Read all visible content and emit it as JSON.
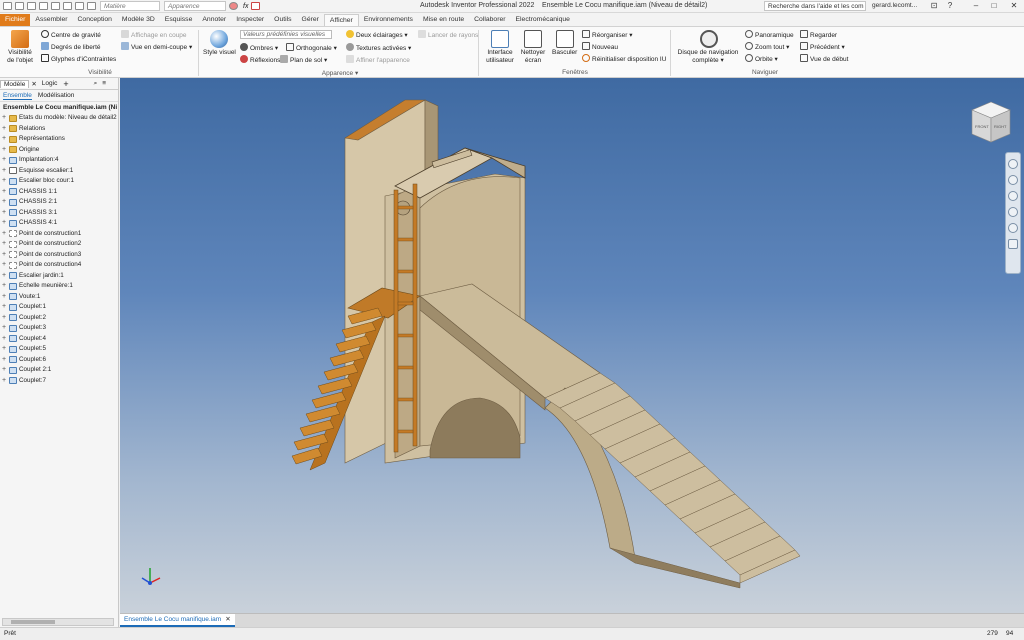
{
  "quick_access": {
    "material_placeholder": "Matière",
    "appearance_placeholder": "Apparence",
    "fx_label": "fx"
  },
  "title": {
    "app": "Autodesk Inventor Professional 2022",
    "document": "Ensemble Le Cocu manifique.iam (Niveau de détail2)"
  },
  "help_search": "Recherche dans l'aide et les com",
  "user": "gerard.lecomt...",
  "ribbon_tabs": [
    "Fichier",
    "Assembler",
    "Conception",
    "Modèle 3D",
    "Esquisse",
    "Annoter",
    "Inspecter",
    "Outils",
    "Gérer",
    "Afficher",
    "Environnements",
    "Mise en route",
    "Collaborer",
    "Electromécanique"
  ],
  "active_tab": "Afficher",
  "ribbon": {
    "visibility": {
      "object_visibility_line1": "Visibilité",
      "object_visibility_line2": "de l'objet",
      "gravity_center": "Centre de gravité",
      "dof": "Degrés de liberté",
      "constraint_glyphs": "Glyphes d'iContraintes",
      "half_section_view": "Affichage en coupe",
      "half_view": "Vue en demi-coupe",
      "group_label": "Visibilité"
    },
    "appearance": {
      "visual_style": "Style visuel",
      "visual_presets": "Valeurs prédéfinies visuelles",
      "two_lights": "Deux éclairages",
      "ray_tracing": "Lancer de rayons",
      "shadows": "Ombres",
      "orthographic": "Orthogonale",
      "textures_on": "Textures activées",
      "reflections": "Réflexions",
      "ground_plane": "Plan de sol",
      "refine_appearance": "Affiner l'apparence",
      "group_label": "Apparence"
    },
    "windows": {
      "ui_line1": "Interface",
      "ui_line2": "utilisateur",
      "clean_line1": "Nettoyer",
      "clean_line2": "écran",
      "switch": "Basculer",
      "arrange": "Réorganiser",
      "new": "Nouveau",
      "reset_ui": "Réinitialiser disposition IU",
      "group_label": "Fenêtres"
    },
    "navigate": {
      "nav_wheel_line1": "Disque de navigation",
      "nav_wheel_line2": "complète",
      "pan": "Panoramique",
      "zoom_all": "Zoom tout",
      "orbit": "Orbite",
      "look": "Regarder",
      "previous": "Précédent",
      "home_view": "Vue de début",
      "group_label": "Naviguer"
    }
  },
  "browser": {
    "tabs": [
      "Modèle",
      "Logic"
    ],
    "subtabs": [
      "Ensemble",
      "Modélisation"
    ],
    "root": "Ensemble Le Cocu manifique.iam (Ni",
    "items": [
      {
        "label": "Etats du modèle: Niveau de détail2",
        "icon": "folder",
        "expand": true
      },
      {
        "label": "Relations",
        "icon": "folder",
        "expand": true
      },
      {
        "label": "Représentations",
        "icon": "folder",
        "expand": true
      },
      {
        "label": "Origine",
        "icon": "folder",
        "expand": true
      },
      {
        "label": "Implantation:4",
        "icon": "part",
        "expand": true
      },
      {
        "label": "Esquisse escalier:1",
        "icon": "sketch",
        "expand": true
      },
      {
        "label": "Escalier bloc cour:1",
        "icon": "part",
        "expand": true
      },
      {
        "label": "CHASSIS 1:1",
        "icon": "part",
        "expand": true
      },
      {
        "label": "CHASSIS 2:1",
        "icon": "part",
        "expand": true
      },
      {
        "label": "CHASSIS 3:1",
        "icon": "part",
        "expand": true
      },
      {
        "label": "CHASSIS 4:1",
        "icon": "part",
        "expand": true
      },
      {
        "label": "Point de construction1",
        "icon": "point",
        "expand": true
      },
      {
        "label": "Point de construction2",
        "icon": "point",
        "expand": true
      },
      {
        "label": "Point de construction3",
        "icon": "point",
        "expand": true
      },
      {
        "label": "Point de construction4",
        "icon": "point",
        "expand": true
      },
      {
        "label": "Escalier jardin:1",
        "icon": "part",
        "expand": true
      },
      {
        "label": "Echelle meunière:1",
        "icon": "part",
        "expand": true
      },
      {
        "label": "Voute:1",
        "icon": "part",
        "expand": true
      },
      {
        "label": "Couplet:1",
        "icon": "part",
        "expand": true
      },
      {
        "label": "Couplet:2",
        "icon": "part",
        "expand": true
      },
      {
        "label": "Couplet:3",
        "icon": "part",
        "expand": true
      },
      {
        "label": "Couplet:4",
        "icon": "part",
        "expand": true
      },
      {
        "label": "Couplet:5",
        "icon": "part",
        "expand": true
      },
      {
        "label": "Couplet:6",
        "icon": "part",
        "expand": true
      },
      {
        "label": "Couplet 2:1",
        "icon": "part",
        "expand": true
      },
      {
        "label": "Couplet:7",
        "icon": "part",
        "expand": true
      }
    ]
  },
  "viewcube": {
    "face_front": "FRONT",
    "face_right": "RIGHT"
  },
  "document_tab": "Ensemble Le Cocu manifique.iam",
  "status": {
    "text": "Prêt",
    "count1": "279",
    "count2": "94"
  }
}
